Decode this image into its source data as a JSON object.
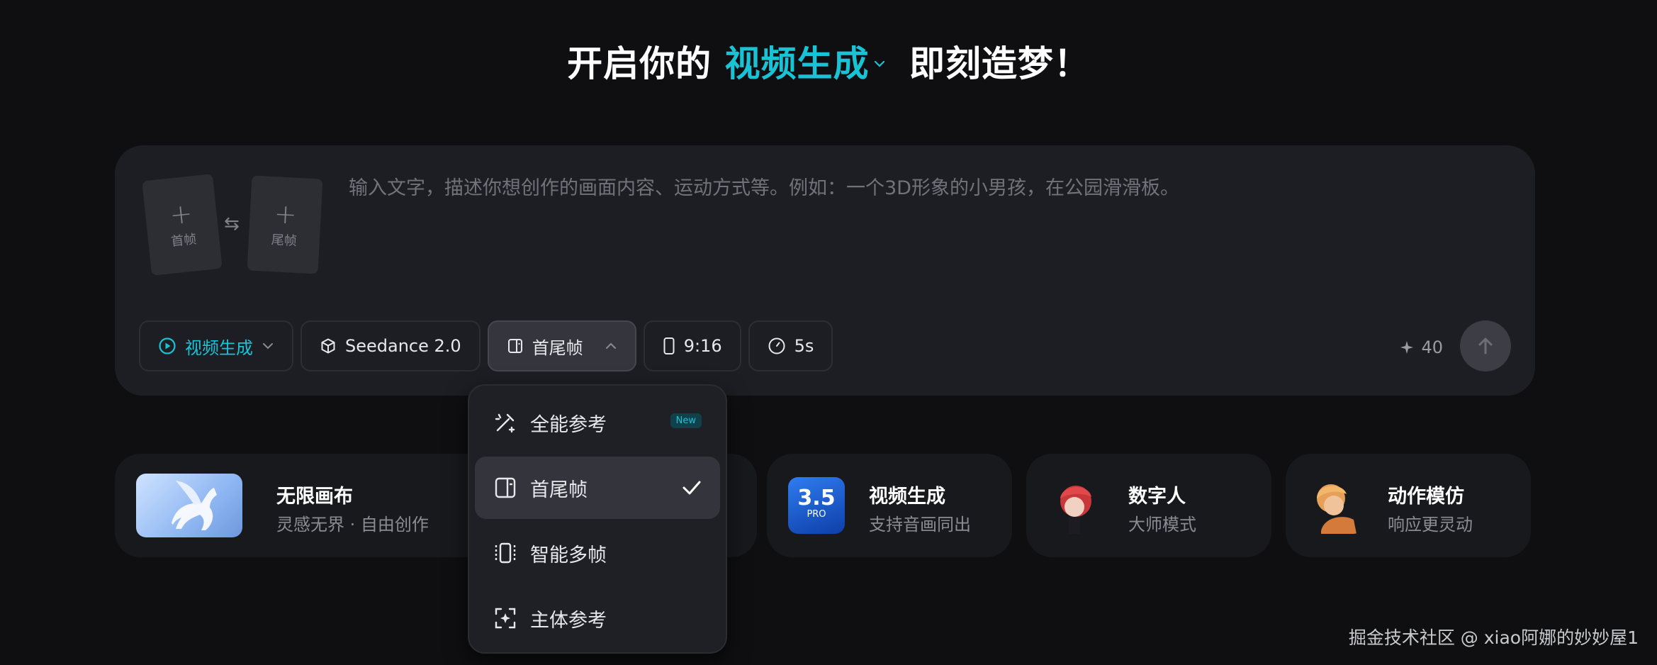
{
  "headline": {
    "prefix": "开启你的",
    "mode": "视频生成",
    "suffix": "即刻造梦！"
  },
  "composer": {
    "first_frame_label": "首帧",
    "last_frame_label": "尾帧",
    "prompt_placeholder": "输入文字，描述你想创作的画面内容、运动方式等。例如：一个3D形象的小男孩，在公园滑滑板。",
    "toolbar": {
      "mode": "视频生成",
      "model": "Seedance 2.0",
      "frame_mode": "首尾帧",
      "ratio": "9:16",
      "duration": "5s"
    },
    "credits": "40"
  },
  "dropdown": {
    "items": [
      {
        "label": "全能参考",
        "badge": "New",
        "icon": "magic-wand-icon"
      },
      {
        "label": "首尾帧",
        "selected": true,
        "icon": "first-last-frame-icon"
      },
      {
        "label": "智能多帧",
        "icon": "multi-frame-icon"
      },
      {
        "label": "主体参考",
        "icon": "subject-focus-icon"
      }
    ]
  },
  "features": [
    {
      "title": "无限画布",
      "subtitle": "灵感无界 · 自由创作",
      "icon": "pegasus-thumbnail"
    },
    {
      "title": "视频生成",
      "subtitle": "支持音画同出",
      "badge_main": "3.5",
      "badge_sub": "PRO",
      "icon": "version-badge-thumbnail"
    },
    {
      "title": "数字人",
      "subtitle": "大师模式",
      "icon": "redhead-avatar"
    },
    {
      "title": "动作模仿",
      "subtitle": "响应更灵动",
      "icon": "blonde-avatar"
    }
  ],
  "watermark": "掘金技术社区 @ xiao阿娜的妙妙屋1",
  "colors": {
    "accent": "#19c3d6",
    "background": "#0f0f12",
    "surface": "#1d1e23"
  }
}
